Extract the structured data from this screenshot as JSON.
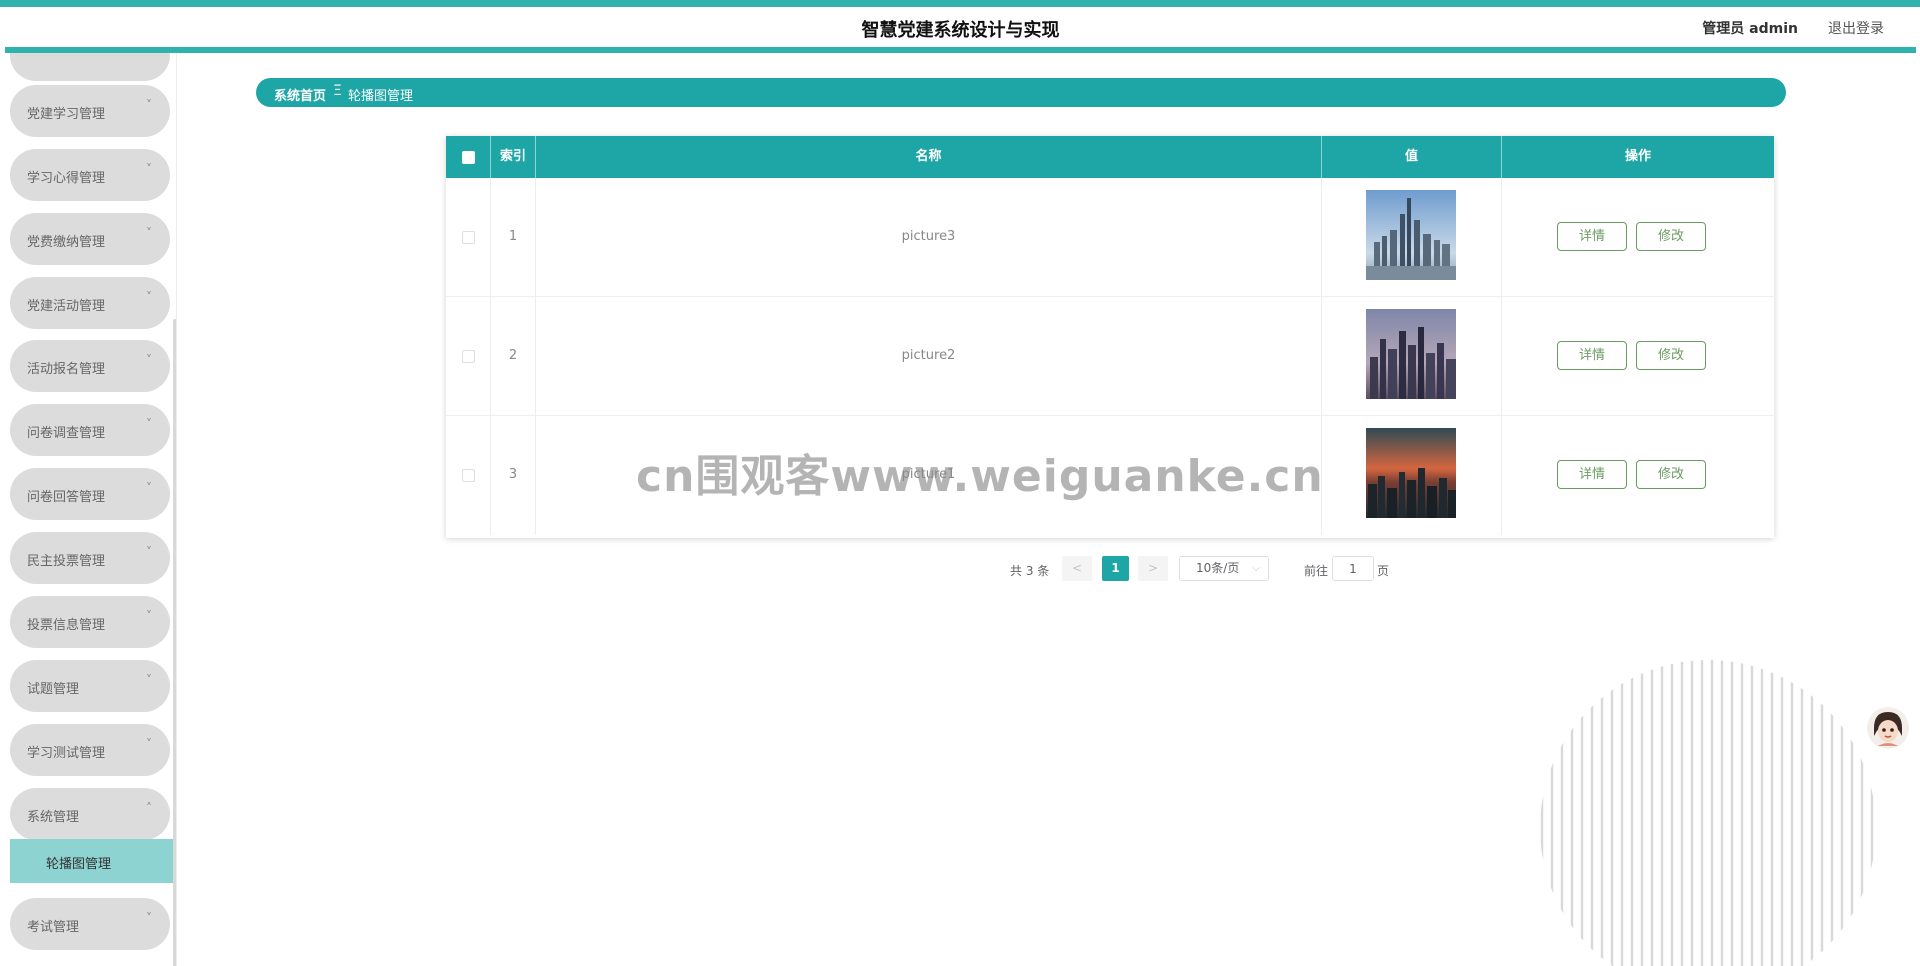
{
  "header": {
    "title": "智慧党建系统设计与实现",
    "role": "管理员 admin",
    "logout": "退出登录"
  },
  "sidebar": {
    "items": [
      {
        "label": "党建学习管理",
        "chevron": "˅"
      },
      {
        "label": "学习心得管理",
        "chevron": "˅"
      },
      {
        "label": "党费缴纳管理",
        "chevron": "˅"
      },
      {
        "label": "党建活动管理",
        "chevron": "˅"
      },
      {
        "label": "活动报名管理",
        "chevron": "˅"
      },
      {
        "label": "问卷调查管理",
        "chevron": "˅"
      },
      {
        "label": "问卷回答管理",
        "chevron": "˅"
      },
      {
        "label": "民主投票管理",
        "chevron": "˅"
      },
      {
        "label": "投票信息管理",
        "chevron": "˅"
      },
      {
        "label": "试题管理",
        "chevron": "˅"
      },
      {
        "label": "学习测试管理",
        "chevron": "˅"
      },
      {
        "label": "系统管理",
        "chevron": "˄"
      },
      {
        "label": "考试管理",
        "chevron": "˅"
      }
    ],
    "active_sub": "轮播图管理"
  },
  "breadcrumb": {
    "home": "系统首页",
    "sep": "Ξ",
    "current": "轮播图管理"
  },
  "table": {
    "headers": {
      "index": "索引",
      "name": "名称",
      "value": "值",
      "ops": "操作"
    },
    "rows": [
      {
        "index": "1",
        "name": "picture3"
      },
      {
        "index": "2",
        "name": "picture2"
      },
      {
        "index": "3",
        "name": "picture1"
      }
    ],
    "detail_label": "详情",
    "edit_label": "修改"
  },
  "pagination": {
    "total": "共 3 条",
    "prev": "<",
    "current": "1",
    "next": ">",
    "page_size": "10条/页",
    "goto_label": "前往",
    "goto_value": "1",
    "page_suffix": "页"
  },
  "watermark": "cn围观客www.weiguanke.cn",
  "colors": {
    "accent": "#1ea6a6",
    "header_stripe": "#2fb1ad",
    "submenu_active": "#8dd3d1",
    "button_text": "#6b9b62"
  },
  "icons": {
    "chevron": "chevron-down-icon",
    "avatar": "assistant-avatar-icon"
  }
}
